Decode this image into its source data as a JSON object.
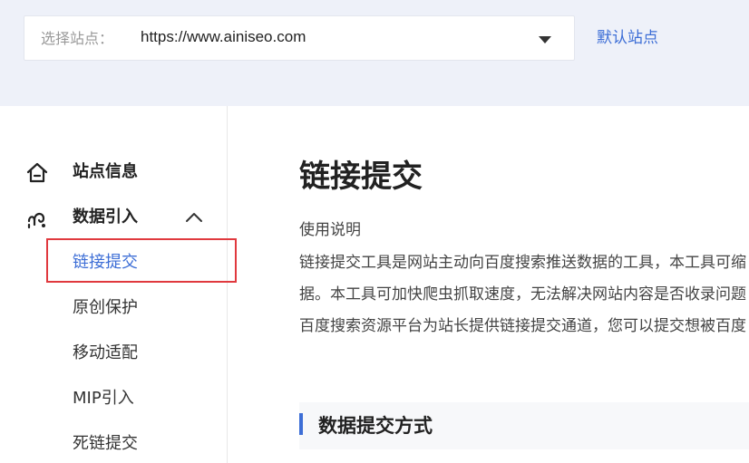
{
  "site_selector": {
    "label": "选择站点：",
    "value": "https://www.ainiseo.com",
    "default_link": "默认站点"
  },
  "sidebar": {
    "items": [
      {
        "label": "站点信息",
        "icon": "home-icon"
      },
      {
        "label": "数据引入",
        "icon": "data-import-icon",
        "expanded": true
      }
    ],
    "sub_items": [
      {
        "label": "链接提交",
        "active": true
      },
      {
        "label": "原创保护"
      },
      {
        "label": "移动适配"
      },
      {
        "label": "MIP引入"
      },
      {
        "label": "死链提交"
      }
    ]
  },
  "main": {
    "title": "链接提交",
    "usage_heading": "使用说明",
    "description_lines": [
      "链接提交工具是网站主动向百度搜索推送数据的工具，本工具可缩",
      "据。本工具可加快爬虫抓取速度，无法解决网站内容是否收录问题",
      "百度搜索资源平台为站长提供链接提交通道，您可以提交想被百度"
    ],
    "section_title": "数据提交方式"
  },
  "colors": {
    "accent": "#3d6ed6",
    "highlight": "#e0393e",
    "top_band": "#eef1f9"
  }
}
